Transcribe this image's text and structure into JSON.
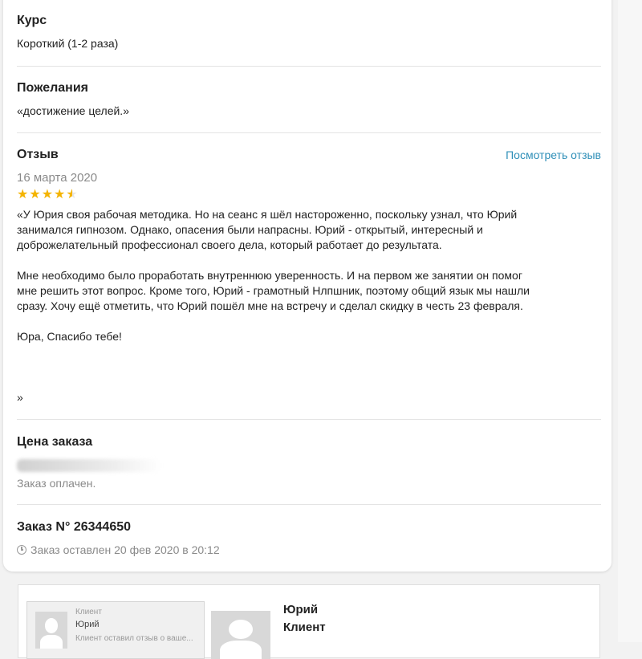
{
  "course": {
    "heading": "Курс",
    "value": "Короткий (1-2 раза)"
  },
  "wishes": {
    "heading": "Пожелания",
    "value": "«достижение целей.»"
  },
  "review": {
    "heading": "Отзыв",
    "view_link": "Посмотреть отзыв",
    "date": "16 марта 2020",
    "rating": 4.5,
    "rating_max": 5,
    "text": "«У Юрия своя рабочая методика. Но на сеанс я шёл настороженно, поскольку узнал, что Юрий\nзанимался гипнозом. Однако, опасения были напрасны. Юрий - открытый, интересный и\nдоброжелательный профессионал своего дела, который работает до результата.\n\nМне необходимо было проработать внутреннюю уверенность. И на первом же занятии он помог\nмне решить этот вопрос. Кроме того, Юрий - грамотный Нлпшник, поэтому общий язык мы нашли\nсразу. Хочу ещё отметить, что Юрий пошёл мне на встречу и сделал скидку в честь 23 февраля.\n\nЮра, Спасибо тебе!\n\n\n\n»"
  },
  "price": {
    "heading": "Цена заказа",
    "status": "Заказ оплачен."
  },
  "order": {
    "heading": "Заказ N° 26344650",
    "placed": "Заказ оставлен 20 фев 2020 в 20:12"
  },
  "client_card": {
    "mini_label_top": "Клиент",
    "mini_name": "Юрий",
    "mini_label_bottom": "Клиент оставил отзыв о ваше...",
    "name": "Юрий",
    "role": "Клиент"
  },
  "colors": {
    "link": "#2f8fb8",
    "star": "#f4b400",
    "muted": "#8a8a8a"
  },
  "icons": {
    "clock": "clock-icon",
    "star": "star-icon",
    "avatar": "user-placeholder-icon"
  }
}
